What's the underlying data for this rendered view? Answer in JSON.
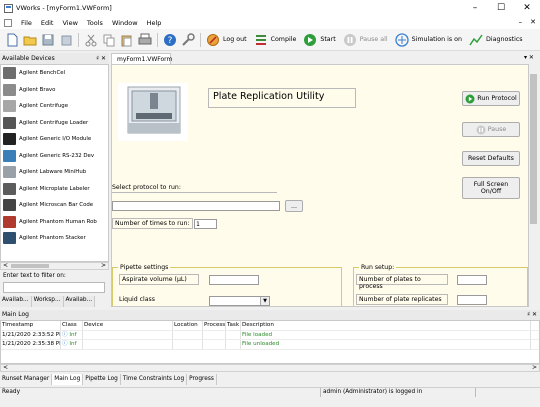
{
  "window": {
    "title": "VWorks - [myForm1.VWForm]",
    "controls": [
      "–",
      "☐",
      "✕"
    ]
  },
  "menu": {
    "items": [
      "File",
      "Edit",
      "View",
      "Tools",
      "Window",
      "Help"
    ],
    "mdi_controls": [
      "–",
      "✕"
    ]
  },
  "toolbar": {
    "logout": "Log out",
    "compile": "Compile",
    "start": "Start",
    "pause_all": "Pause all",
    "simulation": "Simulation is on",
    "diagnostics": "Diagnostics"
  },
  "devices_panel": {
    "title": "Available Devices",
    "pin": "♯",
    "close": "✕",
    "items": [
      {
        "label": "Agilent BenchCel",
        "color": "#6d6d6d"
      },
      {
        "label": "Agilent Bravo",
        "color": "#8b8b8b"
      },
      {
        "label": "Agilent Centrifuge",
        "color": "#a7a7a7"
      },
      {
        "label": "Agilent Centrifuge Loader",
        "color": "#555555"
      },
      {
        "label": "Agilent Generic I/O Module",
        "color": "#222222"
      },
      {
        "label": "Agilent Generic RS-232 Dev",
        "color": "#3a7fb8"
      },
      {
        "label": "Agilent Labware MiniHub",
        "color": "#9aa0a8"
      },
      {
        "label": "Agilent Microplate Labeler",
        "color": "#5c5c5c"
      },
      {
        "label": "Agilent Microscan Bar Code",
        "color": "#444444"
      },
      {
        "label": "Agilent Phantom Human Rob",
        "color": "#b03a2e"
      },
      {
        "label": "Agilent Phantom Stacker",
        "color": "#2f4f6f"
      }
    ],
    "filter_label": "Enter text to filter on:",
    "filter_value": "",
    "tabs": [
      "Availab...",
      "Worksp...",
      "Availab..."
    ]
  },
  "document": {
    "tab_label": "myForm1.VWForm",
    "close": "▾ ✕",
    "form_title": "Plate Replication Utility",
    "buttons": {
      "run": "Run Protocol",
      "pause": "Pause",
      "reset": "Reset Defaults",
      "fullscreen": "Full Screen On/Off"
    },
    "select_protocol_label": "Select protocol to run:",
    "protocol_value": "",
    "browse": "...",
    "times_label": "Number of times to run:",
    "times_value": "1",
    "pipette_settings": {
      "legend": "Pipette settings",
      "aspirate_label": "Aspirate volume (μL)",
      "aspirate_value": "",
      "liquid_label": "Liquid class",
      "liquid_value": ""
    },
    "run_setup": {
      "legend": "Run setup:",
      "plates_label": "Number of plates to process",
      "plates_value": "",
      "replicates_label": "Number of plate replicates",
      "replicates_value": ""
    }
  },
  "main_log": {
    "title": "Main Log",
    "pin": "♯ ✕",
    "columns": [
      "Timestamp",
      "Class",
      "Device",
      "Location",
      "Process",
      "Task",
      "Description"
    ],
    "rows": [
      {
        "timestamp": "1/21/2020 2:33:52 PM",
        "class": "Inf",
        "device": "",
        "location": "",
        "process": "",
        "task": "",
        "description": "File loaded"
      },
      {
        "timestamp": "1/21/2020 2:35:38 PM",
        "class": "Inf",
        "device": "",
        "location": "",
        "process": "",
        "task": "",
        "description": "File unloaded"
      }
    ]
  },
  "bottom_tabs": [
    "Runset Manager",
    "Main Log",
    "Pipette Log",
    "Time Constraints Log",
    "Progress"
  ],
  "status": {
    "left": "Ready",
    "user": "admin (Administrator) is logged in"
  },
  "colors": {
    "form_bg": "#fffceb",
    "accent_green": "#2e9e3a",
    "info_blue": "#3a7fd0",
    "log_green": "#2a8a2a"
  }
}
